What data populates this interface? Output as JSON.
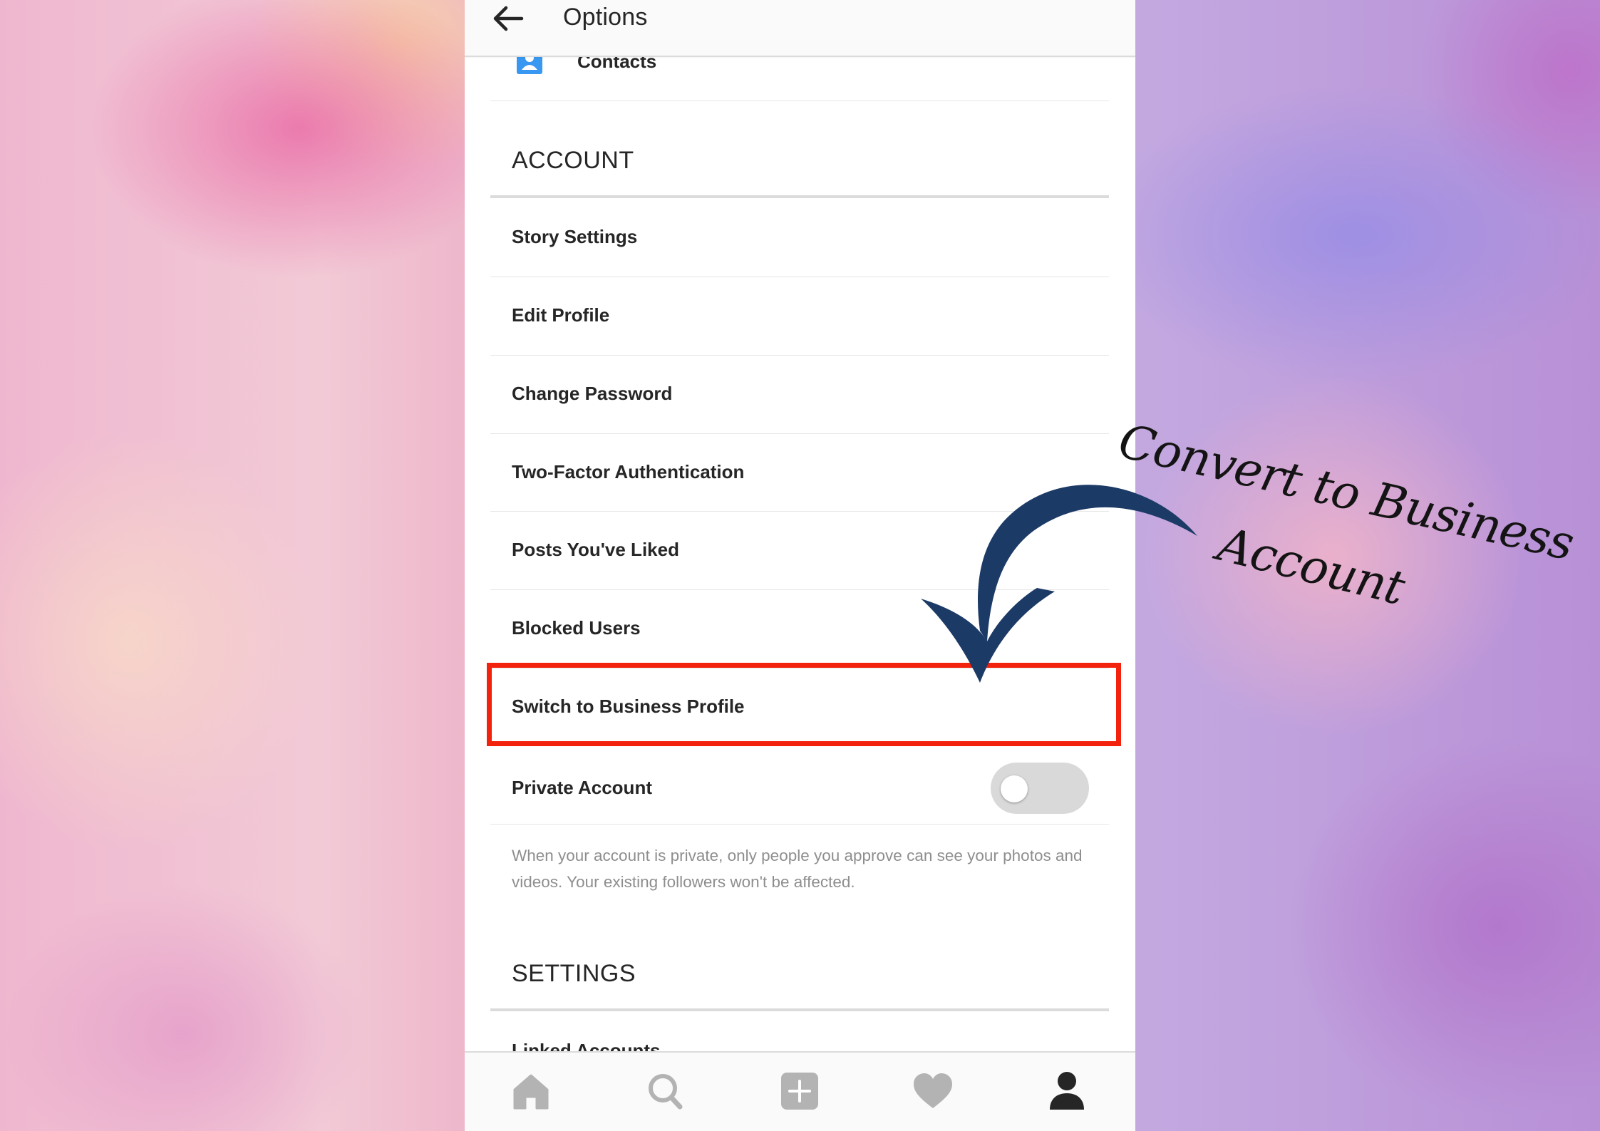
{
  "header": {
    "title": "Options",
    "back_icon": "arrow-left-icon"
  },
  "list": {
    "partial_top_item": {
      "label": "Contacts",
      "icon": "contacts-icon",
      "icon_color": "#3897f0"
    },
    "sections": [
      {
        "title": "ACCOUNT",
        "items": [
          {
            "label": "Story Settings"
          },
          {
            "label": "Edit Profile"
          },
          {
            "label": "Change Password"
          },
          {
            "label": "Two-Factor Authentication"
          },
          {
            "label": "Posts You've Liked"
          },
          {
            "label": "Blocked Users"
          },
          {
            "label": "Switch to Business Profile",
            "highlighted": true
          },
          {
            "label": "Private Account",
            "toggle": true,
            "toggle_on": false
          }
        ],
        "help_text": "When your account is private, only people you approve can see your photos and videos. Your existing followers won't be affected."
      },
      {
        "title": "SETTINGS",
        "items": [
          {
            "label": "Linked Accounts"
          }
        ]
      }
    ]
  },
  "bottom_nav": {
    "items": [
      {
        "icon": "home-icon",
        "active": false
      },
      {
        "icon": "search-icon",
        "active": false
      },
      {
        "icon": "add-post-icon",
        "active": false
      },
      {
        "icon": "heart-icon",
        "active": false
      },
      {
        "icon": "profile-icon",
        "active": true
      }
    ]
  },
  "annotation": {
    "line1": "Convert to Business",
    "line2": "Account",
    "arrow_color": "#1c3a66",
    "highlight_color": "#f2220d"
  },
  "colors": {
    "inactive_icon": "#b3b3b3",
    "active_icon": "#262626",
    "text": "#262626",
    "secondary_text": "#8e8e8e"
  }
}
